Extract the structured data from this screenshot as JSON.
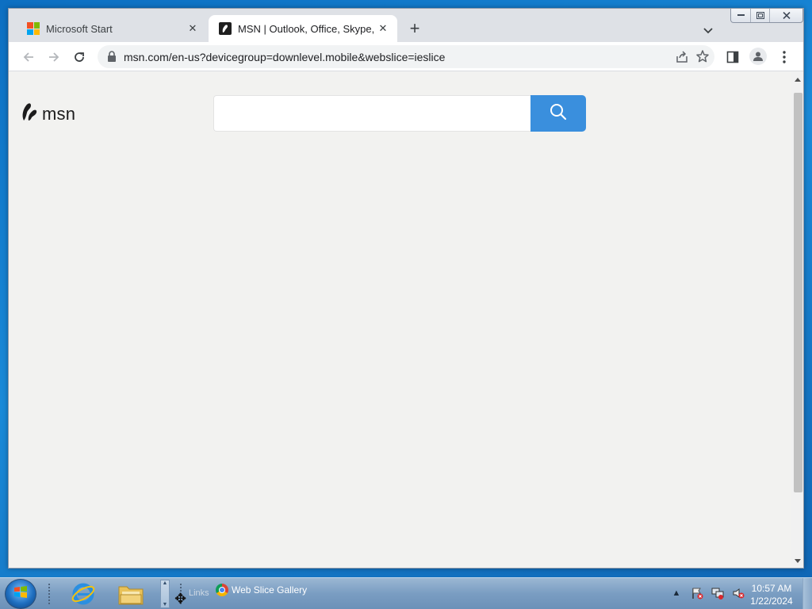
{
  "browser": {
    "tabs": [
      {
        "title": "Microsoft Start",
        "icon": "microsoft-logo-icon",
        "active": false
      },
      {
        "title": "MSN | Outlook, Office, Skype, Bing",
        "icon": "msn-favicon-icon",
        "active": true
      }
    ],
    "new_tab_label": "+",
    "address_bar": {
      "url": "msn.com/en-us?devicegroup=downlevel.mobile&webslice=ieslice"
    }
  },
  "page": {
    "logo_text": "msn",
    "search": {
      "value": "",
      "placeholder": ""
    },
    "accent_color": "#3a8fdd"
  },
  "taskbar": {
    "links_label": "Links",
    "web_slice_label": "Web Slice Gallery",
    "clock": {
      "time": "10:57 AM",
      "date": "1/22/2024"
    }
  }
}
